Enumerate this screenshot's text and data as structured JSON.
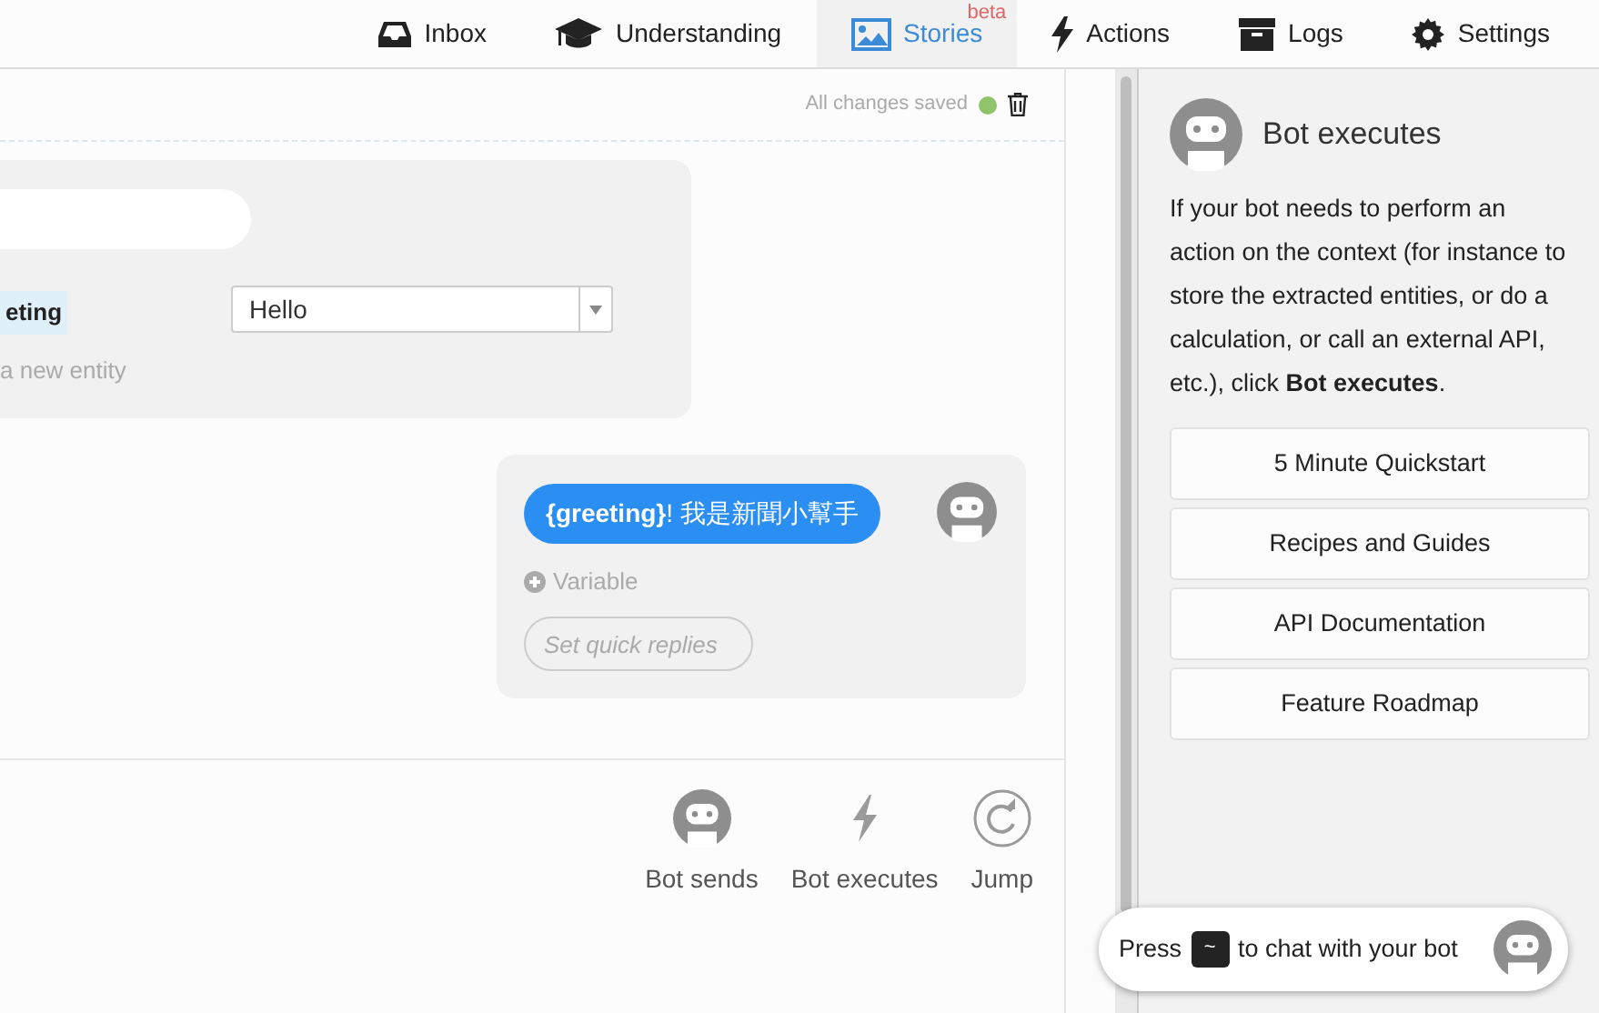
{
  "nav": [
    {
      "label": "Inbox",
      "selected": false
    },
    {
      "label": "Understanding",
      "selected": false
    },
    {
      "label": "Stories",
      "selected": true,
      "badge": "beta"
    },
    {
      "label": "Actions",
      "selected": false
    },
    {
      "label": "Logs",
      "selected": false
    },
    {
      "label": "Settings",
      "selected": false
    }
  ],
  "editor": {
    "save_status": "All changes saved",
    "user_card": {
      "entity_tag": "eting",
      "dropdown_value": "Hello",
      "add_entity": "a new entity"
    },
    "bot_card": {
      "message": "**{greeting}**! 我是新聞小幫手",
      "variable": "Variable",
      "quick_replies_placeholder": "Set quick replies"
    },
    "actions": [
      {
        "label": "Bot sends"
      },
      {
        "label": "Bot executes"
      },
      {
        "label": "Jump"
      }
    ]
  },
  "help_panel": {
    "title": "Bot executes",
    "text": "If your bot needs to perform an action on the context (for instance to store the extracted entities, or do a calculation, or call an external API, etc.), click **Bot executes**.",
    "links": [
      "5 Minute Quickstart",
      "Recipes and Guides",
      "API Documentation",
      "Feature Roadmap"
    ]
  },
  "chat_prompt": {
    "before": "Press",
    "key": "~",
    "after": "to chat with your bot"
  }
}
